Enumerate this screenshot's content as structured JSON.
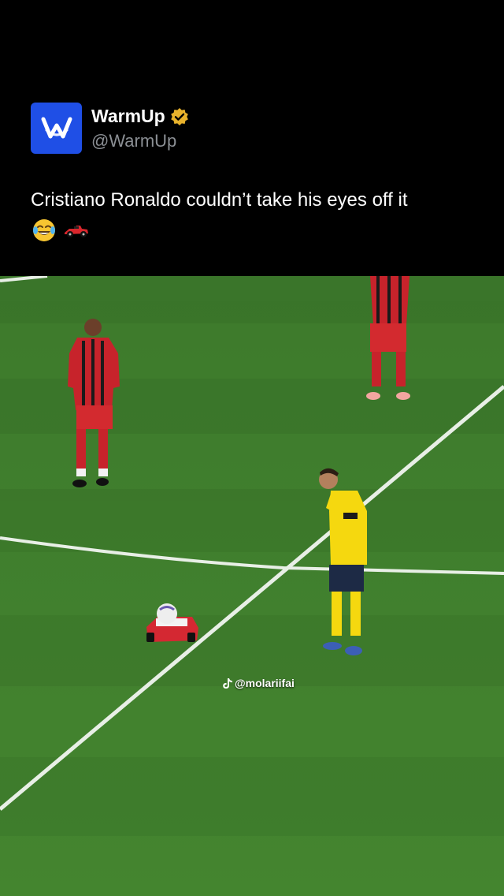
{
  "post": {
    "author_name": "WarmUp",
    "author_handle": "@WarmUp",
    "verified": true,
    "text": "Cristiano Ronaldo couldn’t take his eyes off it",
    "emojis": [
      "face-with-tears-of-joy-icon",
      "race-car-icon"
    ]
  },
  "video": {
    "watermark": "@molariifai",
    "watermark_icon": "tiktok-icon"
  },
  "colors": {
    "background": "#000000",
    "avatar_blue": "#1f4fe6",
    "verified_gold": "#e8b22c",
    "pitch_green": "#3f7a2f",
    "handle_gray": "#8b8f94"
  }
}
